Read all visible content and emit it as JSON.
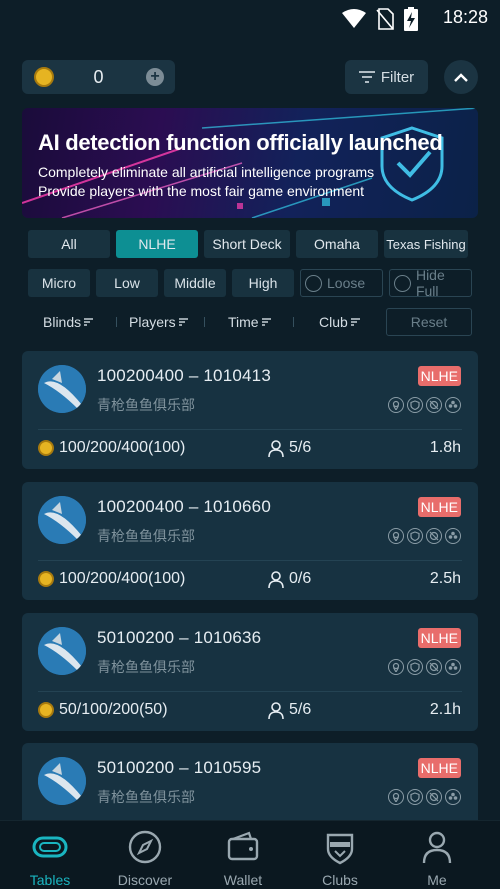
{
  "status": {
    "time": "18:28"
  },
  "topbar": {
    "coin_value": "0",
    "filter_label": "Filter"
  },
  "banner": {
    "title": "AI detection function officially launched",
    "line1": "Completely eliminate all artificial intelligence programs",
    "line2": "Provide players with the most fair game environment"
  },
  "tabs": [
    {
      "label": "All"
    },
    {
      "label": "NLHE"
    },
    {
      "label": "Short Deck"
    },
    {
      "label": "Omaha"
    },
    {
      "label": "Texas Fishing"
    }
  ],
  "levels": [
    {
      "label": "Micro"
    },
    {
      "label": "Low"
    },
    {
      "label": "Middle"
    },
    {
      "label": "High"
    }
  ],
  "checks": {
    "loose": "Loose",
    "hide_full": "Hide Full"
  },
  "sort": {
    "blinds": "Blinds",
    "players": "Players",
    "time": "Time",
    "club": "Club",
    "reset": "Reset"
  },
  "cards": [
    {
      "id": "100200400 – 1010413",
      "club": "青枪鱼鱼俱乐部",
      "badge": "NLHE",
      "blinds": "100/200/400(100)",
      "players": "5/6",
      "duration": "1.8h"
    },
    {
      "id": "100200400 – 1010660",
      "club": "青枪鱼鱼俱乐部",
      "badge": "NLHE",
      "blinds": "100/200/400(100)",
      "players": "0/6",
      "duration": "2.5h"
    },
    {
      "id": "50100200 – 1010636",
      "club": "青枪鱼鱼俱乐部",
      "badge": "NLHE",
      "blinds": "50/100/200(50)",
      "players": "5/6",
      "duration": "2.1h"
    },
    {
      "id": "50100200 – 1010595",
      "club": "青枪鱼鱼俱乐部",
      "badge": "NLHE",
      "blinds": "",
      "players": "",
      "duration": ""
    }
  ],
  "nav": [
    {
      "label": "Tables"
    },
    {
      "label": "Discover"
    },
    {
      "label": "Wallet"
    },
    {
      "label": "Clubs"
    },
    {
      "label": "Me"
    }
  ],
  "colors": {
    "background": "#0d1e28",
    "accent": "#1ab5c0",
    "tab_active": "#0d8f93",
    "badge": "#e86d6b",
    "card": "#173241"
  }
}
